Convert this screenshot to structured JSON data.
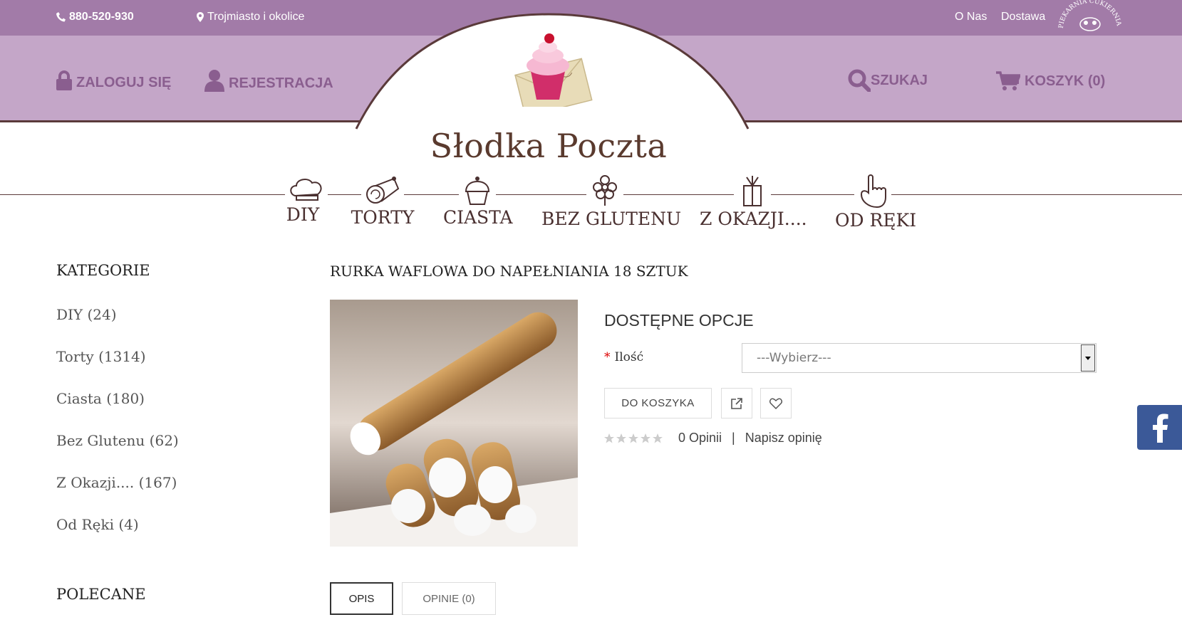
{
  "topbar": {
    "phone": "880-520-930",
    "location": "Trojmiasto i okolice",
    "about": "O Nas",
    "delivery": "Dostawa",
    "badge_text": "PIEKARNIA CUKIERNIA"
  },
  "userbar": {
    "login": "ZALOGUJ SIĘ",
    "register": "REJESTRACJA",
    "search": "SZUKAJ",
    "cart": "KOSZYK (0)"
  },
  "logo": {
    "title": "Słodka Poczta"
  },
  "nav": {
    "items": [
      {
        "label": "DIY",
        "icon": "chef-hat-icon"
      },
      {
        "label": "TORTY",
        "icon": "cake-roll-icon"
      },
      {
        "label": "CIASTA",
        "icon": "cupcake-icon"
      },
      {
        "label": "BEZ GLUTENU",
        "icon": "flower-icon"
      },
      {
        "label": "Z OKAZJI....",
        "icon": "gift-icon"
      },
      {
        "label": "OD RĘKI",
        "icon": "pointing-hand-icon"
      }
    ]
  },
  "sidebar": {
    "title": "KATEGORIE",
    "items": [
      "DIY (24)",
      "Torty (1314)",
      "Ciasta (180)",
      "Bez Glutenu (62)",
      "Z Okazji.... (167)",
      "Od Ręki (4)"
    ],
    "recommended_title": "POLECANE"
  },
  "product": {
    "title": "RURKA WAFLOWA DO NAPEŁNIANIA 18 SZTUK",
    "options_title": "DOSTĘPNE OPCJE",
    "qty_label": "Ilość",
    "qty_placeholder": "---Wybierz---",
    "add_to_cart": "DO KOSZYKA",
    "reviews_count": "0 Opinii",
    "separator": "|",
    "write_review": "Napisz opinię",
    "rating": 0
  },
  "tabs": {
    "description": "OPIS",
    "reviews": "OPINIE (0)"
  },
  "colors": {
    "topbar": "#a27ba8",
    "userbar": "#c4a6c8",
    "brand_text": "#8a5e8f",
    "facebook": "#3b5998"
  }
}
